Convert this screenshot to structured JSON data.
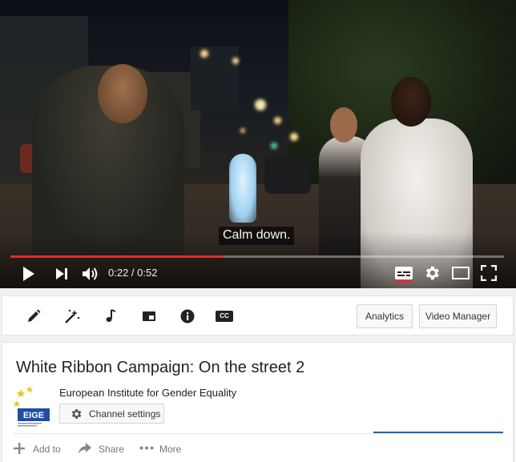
{
  "player": {
    "caption": "Calm down.",
    "time": "0:22 / 0:52",
    "progress_fraction": 0.43,
    "accent_color": "#e52b2b",
    "controls": [
      "play-icon",
      "next-icon",
      "volume-icon",
      "subtitles-icon",
      "gear-icon",
      "theater-icon",
      "fullscreen-icon"
    ]
  },
  "toolbar": {
    "tools": [
      "pencil-icon",
      "magic-wand-icon",
      "music-note-icon",
      "end-screen-icon",
      "info-icon",
      "closed-captions-icon"
    ],
    "cc_text": "CC",
    "analytics_label": "Analytics",
    "video_manager_label": "Video Manager"
  },
  "video": {
    "title": "White Ribbon Campaign: On the street 2",
    "logo_text": "EIGE",
    "channel_name": "European Institute for Gender Equality",
    "channel_settings_label": "Channel settings",
    "actions": {
      "add_to": "Add to",
      "share": "Share",
      "more": "More"
    }
  }
}
